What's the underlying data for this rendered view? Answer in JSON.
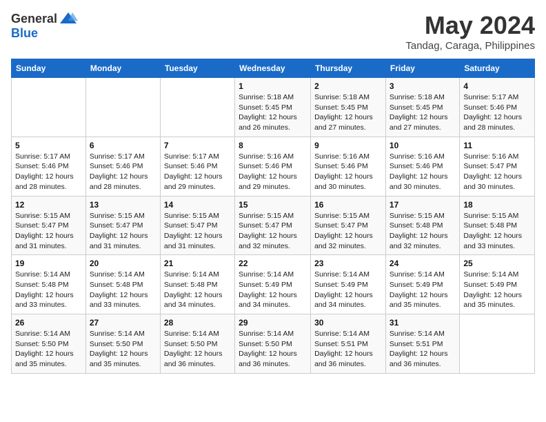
{
  "header": {
    "logo": {
      "general": "General",
      "blue": "Blue"
    },
    "title": "May 2024",
    "subtitle": "Tandag, Caraga, Philippines"
  },
  "calendar": {
    "days_of_week": [
      "Sunday",
      "Monday",
      "Tuesday",
      "Wednesday",
      "Thursday",
      "Friday",
      "Saturday"
    ],
    "weeks": [
      [
        {
          "num": "",
          "info": ""
        },
        {
          "num": "",
          "info": ""
        },
        {
          "num": "",
          "info": ""
        },
        {
          "num": "1",
          "info": "Sunrise: 5:18 AM\nSunset: 5:45 PM\nDaylight: 12 hours and 26 minutes."
        },
        {
          "num": "2",
          "info": "Sunrise: 5:18 AM\nSunset: 5:45 PM\nDaylight: 12 hours and 27 minutes."
        },
        {
          "num": "3",
          "info": "Sunrise: 5:18 AM\nSunset: 5:45 PM\nDaylight: 12 hours and 27 minutes."
        },
        {
          "num": "4",
          "info": "Sunrise: 5:17 AM\nSunset: 5:46 PM\nDaylight: 12 hours and 28 minutes."
        }
      ],
      [
        {
          "num": "5",
          "info": "Sunrise: 5:17 AM\nSunset: 5:46 PM\nDaylight: 12 hours and 28 minutes."
        },
        {
          "num": "6",
          "info": "Sunrise: 5:17 AM\nSunset: 5:46 PM\nDaylight: 12 hours and 28 minutes."
        },
        {
          "num": "7",
          "info": "Sunrise: 5:17 AM\nSunset: 5:46 PM\nDaylight: 12 hours and 29 minutes."
        },
        {
          "num": "8",
          "info": "Sunrise: 5:16 AM\nSunset: 5:46 PM\nDaylight: 12 hours and 29 minutes."
        },
        {
          "num": "9",
          "info": "Sunrise: 5:16 AM\nSunset: 5:46 PM\nDaylight: 12 hours and 30 minutes."
        },
        {
          "num": "10",
          "info": "Sunrise: 5:16 AM\nSunset: 5:46 PM\nDaylight: 12 hours and 30 minutes."
        },
        {
          "num": "11",
          "info": "Sunrise: 5:16 AM\nSunset: 5:47 PM\nDaylight: 12 hours and 30 minutes."
        }
      ],
      [
        {
          "num": "12",
          "info": "Sunrise: 5:15 AM\nSunset: 5:47 PM\nDaylight: 12 hours and 31 minutes."
        },
        {
          "num": "13",
          "info": "Sunrise: 5:15 AM\nSunset: 5:47 PM\nDaylight: 12 hours and 31 minutes."
        },
        {
          "num": "14",
          "info": "Sunrise: 5:15 AM\nSunset: 5:47 PM\nDaylight: 12 hours and 31 minutes."
        },
        {
          "num": "15",
          "info": "Sunrise: 5:15 AM\nSunset: 5:47 PM\nDaylight: 12 hours and 32 minutes."
        },
        {
          "num": "16",
          "info": "Sunrise: 5:15 AM\nSunset: 5:47 PM\nDaylight: 12 hours and 32 minutes."
        },
        {
          "num": "17",
          "info": "Sunrise: 5:15 AM\nSunset: 5:48 PM\nDaylight: 12 hours and 32 minutes."
        },
        {
          "num": "18",
          "info": "Sunrise: 5:15 AM\nSunset: 5:48 PM\nDaylight: 12 hours and 33 minutes."
        }
      ],
      [
        {
          "num": "19",
          "info": "Sunrise: 5:14 AM\nSunset: 5:48 PM\nDaylight: 12 hours and 33 minutes."
        },
        {
          "num": "20",
          "info": "Sunrise: 5:14 AM\nSunset: 5:48 PM\nDaylight: 12 hours and 33 minutes."
        },
        {
          "num": "21",
          "info": "Sunrise: 5:14 AM\nSunset: 5:48 PM\nDaylight: 12 hours and 34 minutes."
        },
        {
          "num": "22",
          "info": "Sunrise: 5:14 AM\nSunset: 5:49 PM\nDaylight: 12 hours and 34 minutes."
        },
        {
          "num": "23",
          "info": "Sunrise: 5:14 AM\nSunset: 5:49 PM\nDaylight: 12 hours and 34 minutes."
        },
        {
          "num": "24",
          "info": "Sunrise: 5:14 AM\nSunset: 5:49 PM\nDaylight: 12 hours and 35 minutes."
        },
        {
          "num": "25",
          "info": "Sunrise: 5:14 AM\nSunset: 5:49 PM\nDaylight: 12 hours and 35 minutes."
        }
      ],
      [
        {
          "num": "26",
          "info": "Sunrise: 5:14 AM\nSunset: 5:50 PM\nDaylight: 12 hours and 35 minutes."
        },
        {
          "num": "27",
          "info": "Sunrise: 5:14 AM\nSunset: 5:50 PM\nDaylight: 12 hours and 35 minutes."
        },
        {
          "num": "28",
          "info": "Sunrise: 5:14 AM\nSunset: 5:50 PM\nDaylight: 12 hours and 36 minutes."
        },
        {
          "num": "29",
          "info": "Sunrise: 5:14 AM\nSunset: 5:50 PM\nDaylight: 12 hours and 36 minutes."
        },
        {
          "num": "30",
          "info": "Sunrise: 5:14 AM\nSunset: 5:51 PM\nDaylight: 12 hours and 36 minutes."
        },
        {
          "num": "31",
          "info": "Sunrise: 5:14 AM\nSunset: 5:51 PM\nDaylight: 12 hours and 36 minutes."
        },
        {
          "num": "",
          "info": ""
        }
      ]
    ]
  }
}
